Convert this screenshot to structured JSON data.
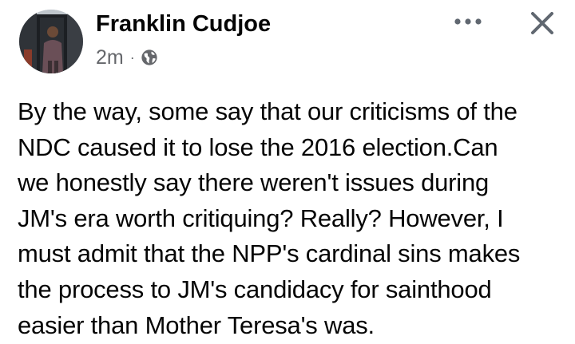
{
  "post": {
    "author": "Franklin Cudjoe",
    "time": "2m",
    "separator": "·",
    "privacy_icon": "globe-icon",
    "more_icon": "more-options-icon",
    "close_icon": "close-icon",
    "text": "By the way, some say that our criticisms of the\nNDC caused it to lose the 2016 election.Can\nwe honestly say there weren't issues during\nJM's era worth critiquing? Really? However, I\nmust admit that the NPP's cardinal sins makes\nthe process to JM's candidacy for sainthood\neasier than Mother Teresa's was."
  },
  "colors": {
    "text": "#050505",
    "secondary_text": "#65676b",
    "icon": "#606770",
    "background": "#ffffff"
  }
}
